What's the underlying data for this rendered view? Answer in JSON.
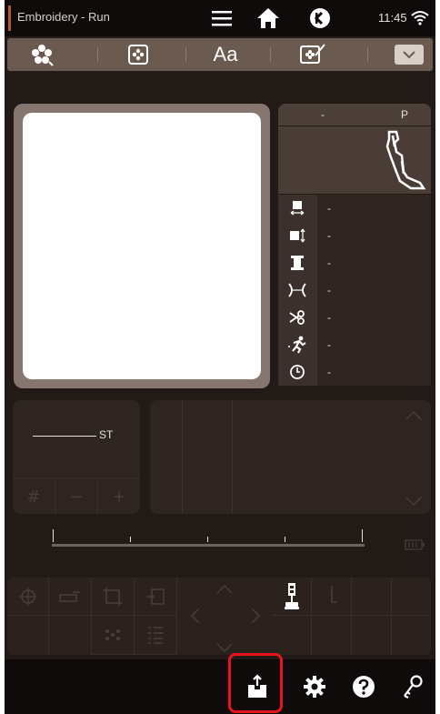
{
  "status_bar": {
    "title": "Embroidery - Run",
    "time": "11:45",
    "icons": [
      "menu-icon",
      "home-icon",
      "mode-switch-icon",
      "wifi-icon"
    ]
  },
  "toolbar": {
    "items": [
      {
        "name": "flower-design-icon"
      },
      {
        "name": "embroidery-pattern-icon"
      },
      {
        "name": "text-font-icon",
        "label": "Aa"
      },
      {
        "name": "edit-design-icon"
      },
      {
        "name": "chevron-down-icon"
      }
    ]
  },
  "foot_panel": {
    "col1": "-",
    "col2": "P",
    "rows": [
      {
        "icon": "width-icon",
        "value": "-"
      },
      {
        "icon": "height-icon",
        "value": "-"
      },
      {
        "icon": "thread-spool-icon",
        "value": "-"
      },
      {
        "icon": "tension-icon",
        "value": "-"
      },
      {
        "icon": "scissors-icon",
        "value": "-"
      },
      {
        "icon": "running-stitch-icon",
        "value": "-"
      },
      {
        "icon": "clock-icon",
        "value": "-"
      }
    ]
  },
  "stitch_panel": {
    "label": "ST",
    "buttons": [
      "#",
      "−",
      "+"
    ]
  },
  "bottom_bar": {
    "icons": [
      "export-icon",
      "settings-icon",
      "help-icon",
      "key-icon"
    ]
  },
  "colors": {
    "accent": "#b85a2c",
    "highlight": "#e8141c",
    "background": "#221a16"
  }
}
